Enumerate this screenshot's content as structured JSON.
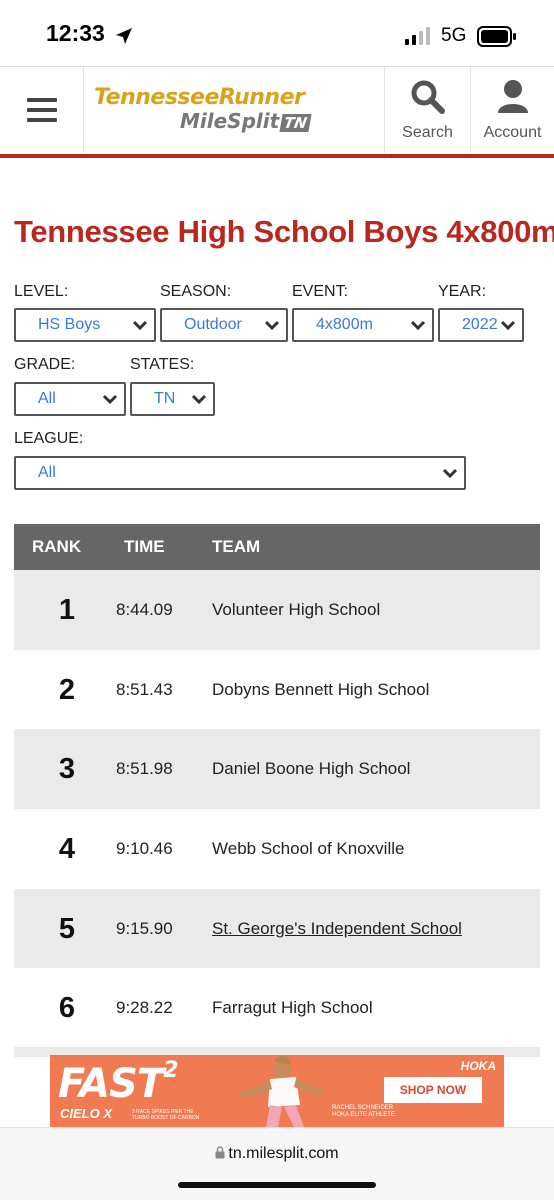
{
  "status_bar": {
    "time": "12:33",
    "network": "5G"
  },
  "header": {
    "logo_line1": "TennesseeRunner",
    "logo_line2": "MileSplit",
    "logo_badge": "TN",
    "search_label": "Search",
    "account_label": "Account"
  },
  "page": {
    "title": "Tennessee High School Boys 4x800m"
  },
  "filters": {
    "level": {
      "label": "LEVEL:",
      "value": "HS Boys"
    },
    "season": {
      "label": "SEASON:",
      "value": "Outdoor"
    },
    "event": {
      "label": "EVENT:",
      "value": "4x800m"
    },
    "year": {
      "label": "YEAR:",
      "value": "2022"
    },
    "grade": {
      "label": "GRADE:",
      "value": "All"
    },
    "states": {
      "label": "STATES:",
      "value": "TN"
    },
    "league": {
      "label": "LEAGUE:",
      "value": "All"
    }
  },
  "table": {
    "headers": {
      "rank": "RANK",
      "time": "TIME",
      "team": "TEAM"
    },
    "rows": [
      {
        "rank": "1",
        "time": "8:44.09",
        "team": "Volunteer High School"
      },
      {
        "rank": "2",
        "time": "8:51.43",
        "team": "Dobyns Bennett High School"
      },
      {
        "rank": "3",
        "time": "8:51.98",
        "team": "Daniel Boone High School"
      },
      {
        "rank": "4",
        "time": "9:10.46",
        "team": "Webb School of Knoxville"
      },
      {
        "rank": "5",
        "time": "9:15.90",
        "team": "St. George's Independent School"
      },
      {
        "rank": "6",
        "time": "9:28.22",
        "team": "Farragut High School"
      }
    ]
  },
  "ad": {
    "headline": "FAST",
    "headline_sup": "2",
    "product": "CIELO X",
    "tagline": "3 RACE SPIKES PAIR THE TURBO BOOST OF CARBON",
    "brand": "HOKA",
    "cta": "SHOP NOW",
    "athlete_name": "RACHEL SCHNEIDER",
    "athlete_title": "HOKA ELITE ATHLETE"
  },
  "browser": {
    "url": "tn.milesplit.com"
  },
  "colors": {
    "brand_red": "#b8281e",
    "link_blue": "#3a7bd5",
    "table_header": "#666666",
    "ad_orange": "#f07a52",
    "logo_gold": "#d9a21b"
  }
}
